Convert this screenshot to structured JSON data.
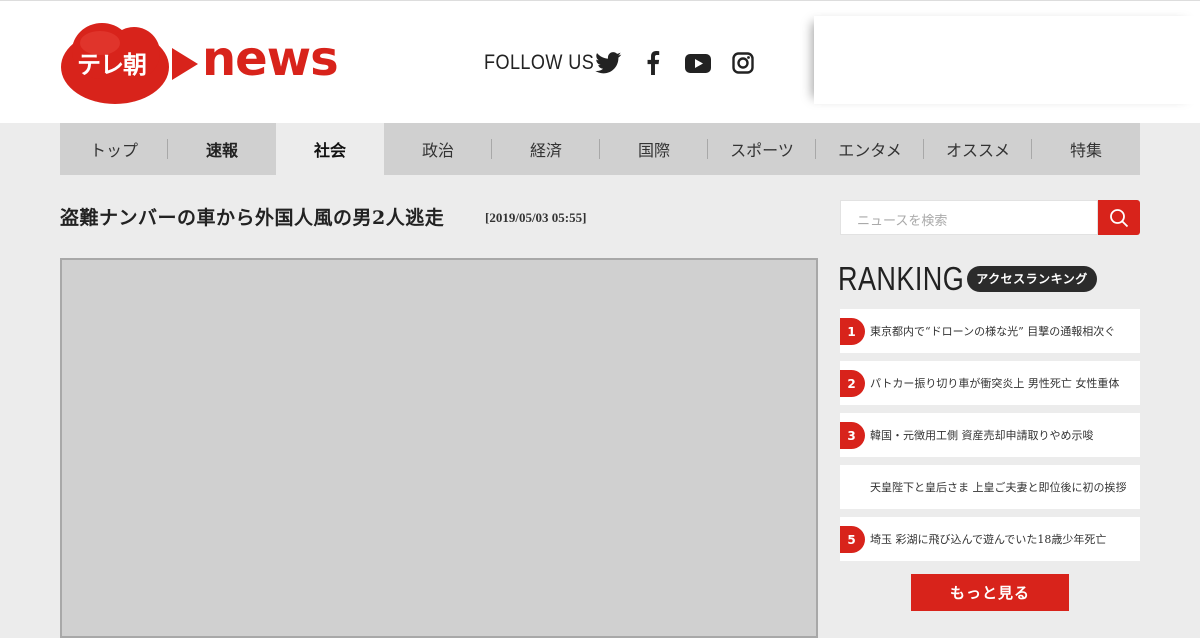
{
  "brand": {
    "logo_text": "テレ朝",
    "logo_news": "news",
    "accent_color": "#d8231b"
  },
  "header": {
    "follow_label": "FOLLOW US",
    "social": [
      {
        "name": "twitter-icon"
      },
      {
        "name": "facebook-icon"
      },
      {
        "name": "youtube-icon"
      },
      {
        "name": "instagram-icon"
      }
    ]
  },
  "nav": {
    "items": [
      {
        "label": "トップ"
      },
      {
        "label": "速報"
      },
      {
        "label": "社会",
        "active": true
      },
      {
        "label": "政治"
      },
      {
        "label": "経済"
      },
      {
        "label": "国際"
      },
      {
        "label": "スポーツ"
      },
      {
        "label": "エンタメ"
      },
      {
        "label": "オススメ"
      },
      {
        "label": "特集"
      }
    ]
  },
  "article": {
    "title": "盗難ナンバーの車から外国人風の男2人逃走",
    "datetime": "[2019/05/03 05:55]"
  },
  "search": {
    "placeholder": "ニュースを検索"
  },
  "ranking": {
    "title": "RANKING",
    "subtitle": "アクセスランキング",
    "items": [
      {
        "rank": "1",
        "text": "東京都内で“ドローンの様な光” 目撃の通報相次ぐ"
      },
      {
        "rank": "2",
        "text": "パトカー振り切り車が衝突炎上 男性死亡 女性重体"
      },
      {
        "rank": "3",
        "text": "韓国・元徴用工側 資産売却申請取りやめ示唆"
      },
      {
        "rank": "",
        "text": "天皇陛下と皇后さま 上皇ご夫妻と即位後に初の挨拶"
      },
      {
        "rank": "5",
        "text": "埼玉 彩湖に飛び込んで遊んでいた18歳少年死亡"
      }
    ],
    "more_label": "もっと見る"
  }
}
